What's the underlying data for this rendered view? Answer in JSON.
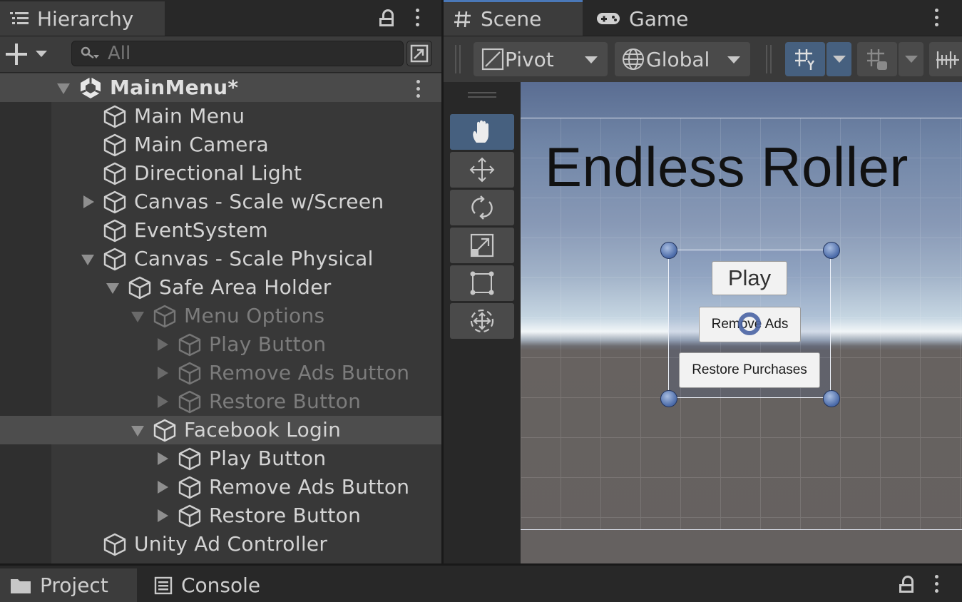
{
  "hierarchy": {
    "tab_label": "Hierarchy",
    "search_placeholder": "All",
    "rows": [
      {
        "label": "MainMenu*"
      },
      {
        "label": "Main Menu"
      },
      {
        "label": "Main Camera"
      },
      {
        "label": "Directional Light"
      },
      {
        "label": "Canvas - Scale w/Screen"
      },
      {
        "label": "EventSystem"
      },
      {
        "label": "Canvas - Scale Physical"
      },
      {
        "label": "Safe Area Holder"
      },
      {
        "label": "Menu Options"
      },
      {
        "label": "Play Button"
      },
      {
        "label": "Remove Ads Button"
      },
      {
        "label": "Restore Button"
      },
      {
        "label": "Facebook Login"
      },
      {
        "label": "Play Button"
      },
      {
        "label": "Remove Ads Button"
      },
      {
        "label": "Restore Button"
      },
      {
        "label": "Unity Ad Controller"
      }
    ]
  },
  "scene": {
    "tabs": [
      {
        "label": "Scene"
      },
      {
        "label": "Game"
      }
    ],
    "toolbar": {
      "pivot_label": "Pivot",
      "global_label": "Global"
    },
    "game_title": "Endless Roller",
    "buttons": {
      "play": "Play",
      "remove_ads": "Remove Ads",
      "restore": "Restore Purchases"
    }
  },
  "bottom": {
    "tabs": [
      {
        "label": "Project"
      },
      {
        "label": "Console"
      }
    ]
  },
  "colors": {
    "panel_bg": "#383838",
    "accent_blue": "#46607f",
    "sky_top": "#5a6d92",
    "ground": "#656160"
  }
}
